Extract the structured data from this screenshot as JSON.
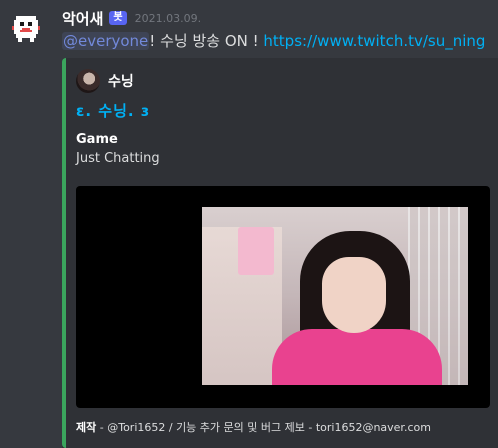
{
  "message": {
    "author": "악어새",
    "bot_tag": "봇",
    "timestamp": "2021.03.09.",
    "mention": "@everyone",
    "text": "! 수닝 방송 ON ! ",
    "link": "https://www.twitch.tv/su_ning"
  },
  "embed": {
    "author_name": "수닝",
    "title": "ε. 수닝. ɜ",
    "field_name": "Game",
    "field_value": "Just Chatting",
    "footer_prefix": "제작",
    "footer_text": " - @Tori1652 / 기능 추가 문의 및 버그 제보 - tori1652@naver.com",
    "color": "#3ba55d"
  },
  "colors": {
    "background": "#36393f",
    "embed_bg": "#2f3136",
    "link": "#00b0f4",
    "mention": "#7289da",
    "bot_tag": "#5865f2"
  }
}
